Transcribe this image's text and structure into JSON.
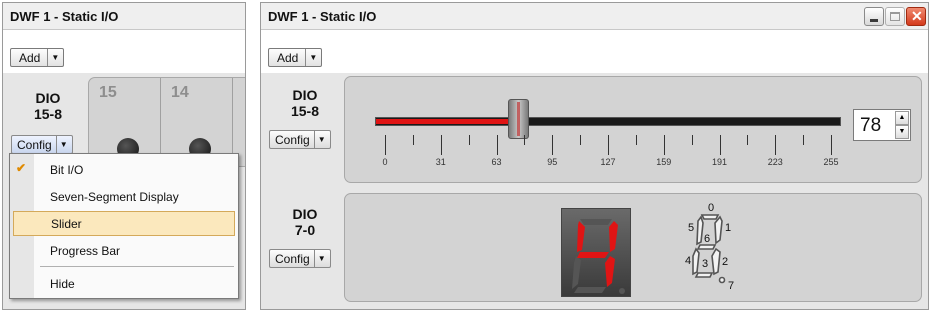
{
  "left_window": {
    "title": "DWF 1 - Static I/O",
    "add_label": "Add",
    "group_label": "DIO\n15-8",
    "group_line1": "DIO",
    "group_line2": "15-8",
    "config_label": "Config",
    "bits": [
      "15",
      "14"
    ],
    "menu": {
      "items": [
        {
          "label": "Bit I/O",
          "checked": true
        },
        {
          "label": "Seven-Segment Display",
          "checked": false
        },
        {
          "label": "Slider",
          "checked": false,
          "highlighted": true
        },
        {
          "label": "Progress Bar",
          "checked": false
        },
        {
          "label": "Hide",
          "checked": false
        }
      ]
    }
  },
  "right_window": {
    "title": "DWF 1 - Static I/O",
    "add_label": "Add",
    "group1": {
      "line1": "DIO",
      "line2": "15-8",
      "config_label": "Config"
    },
    "group2": {
      "line1": "DIO",
      "line2": "7-0",
      "config_label": "Config"
    },
    "slider": {
      "value": 78,
      "min": 0,
      "max": 255,
      "ticks": [
        "0",
        "31",
        "63",
        "95",
        "127",
        "159",
        "191",
        "223",
        "255"
      ],
      "fill_color": "#e01414"
    },
    "display": {
      "digit": "4",
      "seg_color": "#e01414"
    },
    "segment_labels": {
      "a": "0",
      "b": "1",
      "c": "2",
      "d": "3",
      "e": "4",
      "f": "5",
      "g": "6",
      "dp": "7"
    }
  }
}
